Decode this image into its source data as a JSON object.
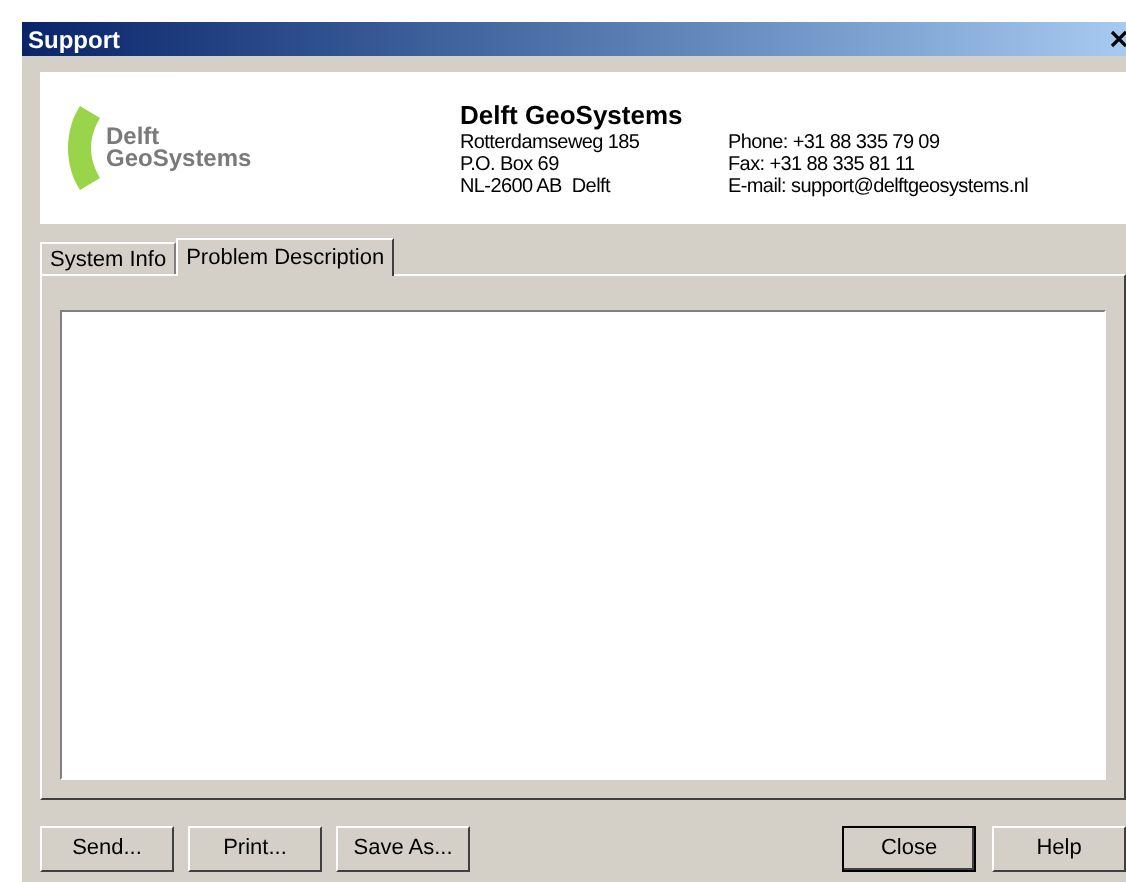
{
  "window": {
    "title": "Support"
  },
  "header": {
    "logo_text": [
      "Delft",
      "GeoSystems"
    ],
    "company": "Delft GeoSystems",
    "address": [
      "Rotterdamseweg 185",
      "P.O. Box 69",
      "NL-2600 AB  Delft"
    ],
    "contact": [
      "Phone: +31 88 335 79 09",
      "Fax: +31 88 335 81 11",
      "E-mail: support@delftgeosystems.nl"
    ]
  },
  "tabs": [
    {
      "label": "System Info",
      "selected": false
    },
    {
      "label": "Problem Description",
      "selected": true
    }
  ],
  "left_buttons": [
    {
      "label": "Send...",
      "default": false
    },
    {
      "label": "Print...",
      "default": false
    },
    {
      "label": "Save As...",
      "default": false
    }
  ],
  "right_buttons": [
    {
      "label": "Close",
      "default": true
    },
    {
      "label": "Help",
      "default": false
    }
  ]
}
